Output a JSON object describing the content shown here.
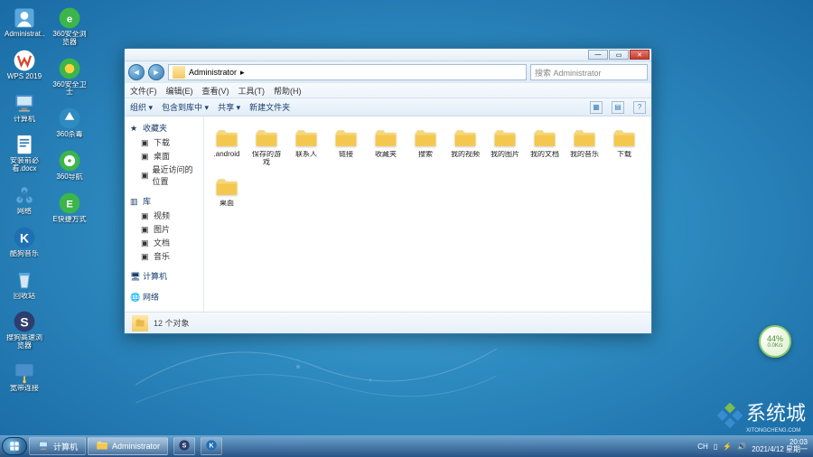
{
  "desktop": {
    "icons": [
      {
        "label": "Administrat...",
        "icon": "user"
      },
      {
        "label": "WPS 2019",
        "icon": "wps"
      },
      {
        "label": "计算机",
        "icon": "computer"
      },
      {
        "label": "安装前必看.docx",
        "icon": "doc"
      },
      {
        "label": "网络",
        "icon": "network"
      },
      {
        "label": "酷狗音乐",
        "icon": "kugou"
      },
      {
        "label": "回收站",
        "icon": "recycle"
      },
      {
        "label": "搜狗高速浏览器",
        "icon": "sogou"
      },
      {
        "label": "宽带连接",
        "icon": "dialup"
      },
      {
        "label": "360安全浏览器",
        "icon": "360browser"
      },
      {
        "label": "360安全卫士",
        "icon": "360safe"
      },
      {
        "label": "360杀毒",
        "icon": "360av"
      },
      {
        "label": "360导航",
        "icon": "360nav"
      },
      {
        "label": "E快捷方式",
        "icon": "eshort"
      }
    ]
  },
  "explorer": {
    "path_segments": [
      "Administrator",
      "▸"
    ],
    "search_placeholder": "搜索 Administrator",
    "menus": [
      "文件(F)",
      "编辑(E)",
      "查看(V)",
      "工具(T)",
      "帮助(H)"
    ],
    "toolbar": {
      "organize": "组织 ▾",
      "include": "包含到库中 ▾",
      "share": "共享 ▾",
      "newfolder": "新建文件夹"
    },
    "nav": {
      "favorites": {
        "header": "收藏夹",
        "items": [
          "下载",
          "桌面",
          "最近访问的位置"
        ]
      },
      "libraries": {
        "header": "库",
        "items": [
          "视频",
          "图片",
          "文档",
          "音乐"
        ]
      },
      "computer": {
        "header": "计算机"
      },
      "network": {
        "header": "网络"
      }
    },
    "files": [
      {
        "label": ".android",
        "type": "folder"
      },
      {
        "label": "保存的游戏",
        "type": "folder"
      },
      {
        "label": "联系人",
        "type": "folder"
      },
      {
        "label": "链接",
        "type": "folder"
      },
      {
        "label": "收藏夹",
        "type": "folder"
      },
      {
        "label": "搜索",
        "type": "folder"
      },
      {
        "label": "我的视频",
        "type": "folder"
      },
      {
        "label": "我的图片",
        "type": "folder"
      },
      {
        "label": "我的文档",
        "type": "folder"
      },
      {
        "label": "我的音乐",
        "type": "folder"
      },
      {
        "label": "下载",
        "type": "folder"
      },
      {
        "label": "桌面",
        "type": "folder"
      }
    ],
    "status": "12 个对象"
  },
  "taskbar": {
    "buttons": [
      {
        "label": "计算机",
        "icon": "computer"
      },
      {
        "label": "Administrator",
        "icon": "folder",
        "active": true
      }
    ],
    "pinned": [
      "sogou",
      "kugou"
    ],
    "tray": {
      "lang": "CH",
      "time": "20:03",
      "date": "2021/4/12 星期一"
    }
  },
  "badge": {
    "percent": "44%",
    "speed": "0.0K/s"
  },
  "watermark": {
    "text": "系统城",
    "sub": "XITONGCHENG.COM"
  }
}
